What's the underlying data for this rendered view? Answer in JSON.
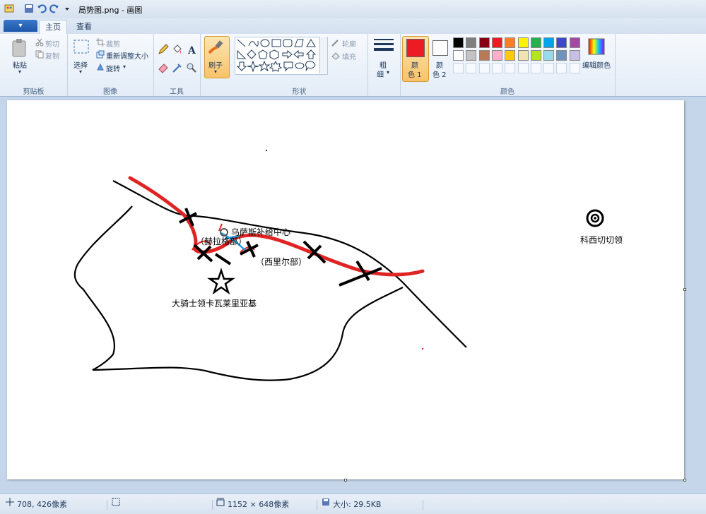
{
  "window": {
    "title": "局势图.png - 画图"
  },
  "tabs": {
    "file_label": "▾",
    "home": "主页",
    "view": "查看"
  },
  "clipboard": {
    "paste": "粘贴",
    "cut": "剪切",
    "copy": "复制",
    "group": "剪贴板"
  },
  "image": {
    "select": "选择",
    "crop": "裁剪",
    "resize": "重新调整大小",
    "rotate": "旋转",
    "group": "图像"
  },
  "tools": {
    "group": "工具"
  },
  "brush": {
    "label": "刷子"
  },
  "shapes": {
    "outline": "轮廓",
    "fill": "填充",
    "group": "形状"
  },
  "size": {
    "label1": "粗",
    "label2": "细"
  },
  "colors": {
    "color1_label1": "颜",
    "color1_label2": "色 1",
    "color2_label1": "颜",
    "color2_label2": "色 2",
    "edit": "编辑颜色",
    "group": "颜色",
    "color1": "#ed1c24",
    "color2": "#ffffff",
    "palette_row1": [
      "#000000",
      "#7f7f7f",
      "#880015",
      "#ed1c24",
      "#ff7f27",
      "#fff200",
      "#22b14c",
      "#00a2e8",
      "#3f48cc",
      "#a349a4"
    ],
    "palette_row2": [
      "#ffffff",
      "#c3c3c3",
      "#b97a57",
      "#ffaec9",
      "#ffc90e",
      "#efe4b0",
      "#b5e61d",
      "#99d9ea",
      "#7092be",
      "#c8bfe7"
    ]
  },
  "map": {
    "supply_center": "乌萨斯补给中心",
    "tribe1": "（赫拉格部）",
    "tribe2": "（西里尔部）",
    "knight": "大骑士领卡瓦莱里亚基",
    "kaz": "科西切切领"
  },
  "status": {
    "cursor": "708, 426像素",
    "dimensions": "1152 × 648像素",
    "filesize": "大小: 29.5KB"
  }
}
